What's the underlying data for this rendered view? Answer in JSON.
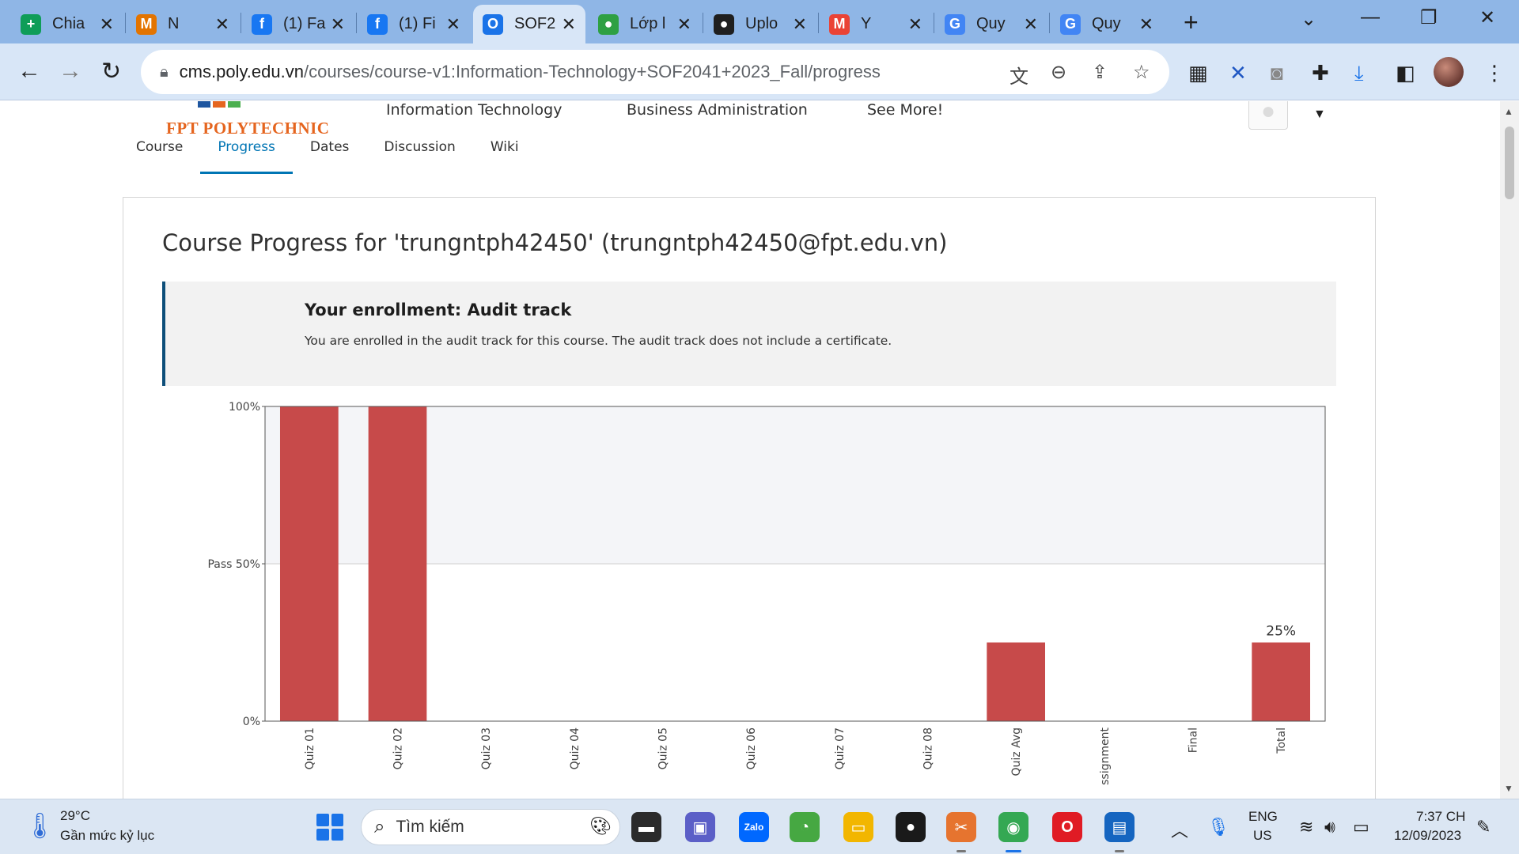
{
  "browser": {
    "tabs": [
      {
        "title": "Chia",
        "icon": "sheets-icon",
        "color": "#0f9d58",
        "glyph": "+"
      },
      {
        "title": "N",
        "icon": "meet-icon",
        "color": "#e37400",
        "glyph": "M"
      },
      {
        "title": "(1) Fa",
        "icon": "facebook-icon",
        "color": "#1877f2",
        "glyph": "f"
      },
      {
        "title": "(1) Fi",
        "icon": "facebook-icon",
        "color": "#1877f2",
        "glyph": "f"
      },
      {
        "title": "SOF2",
        "icon": "poly-icon",
        "color": "#1a73e8",
        "glyph": "O"
      },
      {
        "title": "Lớp l",
        "icon": "github-icon",
        "color": "#2ea043",
        "glyph": "●"
      },
      {
        "title": "Uplo",
        "icon": "github-icon",
        "color": "#1f1f1f",
        "glyph": "●"
      },
      {
        "title": "Y",
        "icon": "gmail-icon",
        "color": "#ea4335",
        "glyph": "M"
      },
      {
        "title": "Quy",
        "icon": "google-icon",
        "color": "#4285f4",
        "glyph": "G"
      },
      {
        "title": "Quy",
        "icon": "google-icon",
        "color": "#4285f4",
        "glyph": "G"
      }
    ],
    "url_host": "cms.poly.edu.vn",
    "url_path": "/courses/course-v1:Information-Technology+SOF2041+2023_Fall/progress"
  },
  "site": {
    "logo_text": "FPT POLYTECHNIC",
    "nav": [
      "Information Technology",
      "Business Administration",
      "See More!"
    ]
  },
  "course_tabs": [
    {
      "label": "Course",
      "active": false
    },
    {
      "label": "Progress",
      "active": true
    },
    {
      "label": "Dates",
      "active": false
    },
    {
      "label": "Discussion",
      "active": false
    },
    {
      "label": "Wiki",
      "active": false
    }
  ],
  "page": {
    "title": "Course Progress for 'trungntph42450' (trungntph42450@fpt.edu.vn)"
  },
  "enrollment": {
    "title": "Your enrollment: Audit track",
    "description": "You are enrolled in the audit track for this course. The audit track does not include a certificate."
  },
  "chart_data": {
    "type": "bar",
    "categories": [
      "Quiz 01",
      "Quiz 02",
      "Quiz 03",
      "Quiz 04",
      "Quiz 05",
      "Quiz 06",
      "Quiz 07",
      "Quiz 08",
      "Quiz Avg",
      "ssignment",
      "Final",
      "Total"
    ],
    "values": [
      100,
      100,
      0,
      0,
      0,
      0,
      0,
      0,
      25,
      0,
      0,
      25
    ],
    "ytick_labels": [
      "0%",
      "Pass 50%",
      "100%"
    ],
    "ytick_values": [
      0,
      50,
      100
    ],
    "ylim": [
      0,
      100
    ],
    "pass_threshold": 50,
    "data_labels": [
      {
        "category": "Total",
        "text": "25%"
      }
    ],
    "bar_color": "#c74a4a",
    "pass_region_color": "#f4f5f8",
    "xlabel": "",
    "ylabel": ""
  },
  "taskbar": {
    "weather_temp": "29°C",
    "weather_desc": "Gần mức kỷ lục",
    "search_placeholder": "Tìm kiếm",
    "lang_line1": "ENG",
    "lang_line2": "US",
    "time": "7:37 CH",
    "date": "12/09/2023",
    "apps": [
      {
        "name": "file-explorer-dark-icon",
        "color": "#2b2b2b",
        "glyph": "▬"
      },
      {
        "name": "teams-icon",
        "color": "#5b5fc7",
        "glyph": "▣"
      },
      {
        "name": "zalo-icon",
        "color": "#0068ff",
        "glyph": "Zalo"
      },
      {
        "name": "coccoc-icon",
        "color": "#46a842",
        "glyph": "◔"
      },
      {
        "name": "folder-icon",
        "color": "#f2b600",
        "glyph": "▭"
      },
      {
        "name": "record-icon",
        "color": "#1a1a1a",
        "glyph": "●"
      },
      {
        "name": "snipping-icon",
        "color": "#e6742f",
        "glyph": "✂"
      },
      {
        "name": "chrome-icon",
        "color": "#34a853",
        "glyph": "◉"
      },
      {
        "name": "opera-icon",
        "color": "#e01b24",
        "glyph": "O"
      },
      {
        "name": "remote-desktop-icon",
        "color": "#1565c0",
        "glyph": "▤"
      }
    ]
  }
}
